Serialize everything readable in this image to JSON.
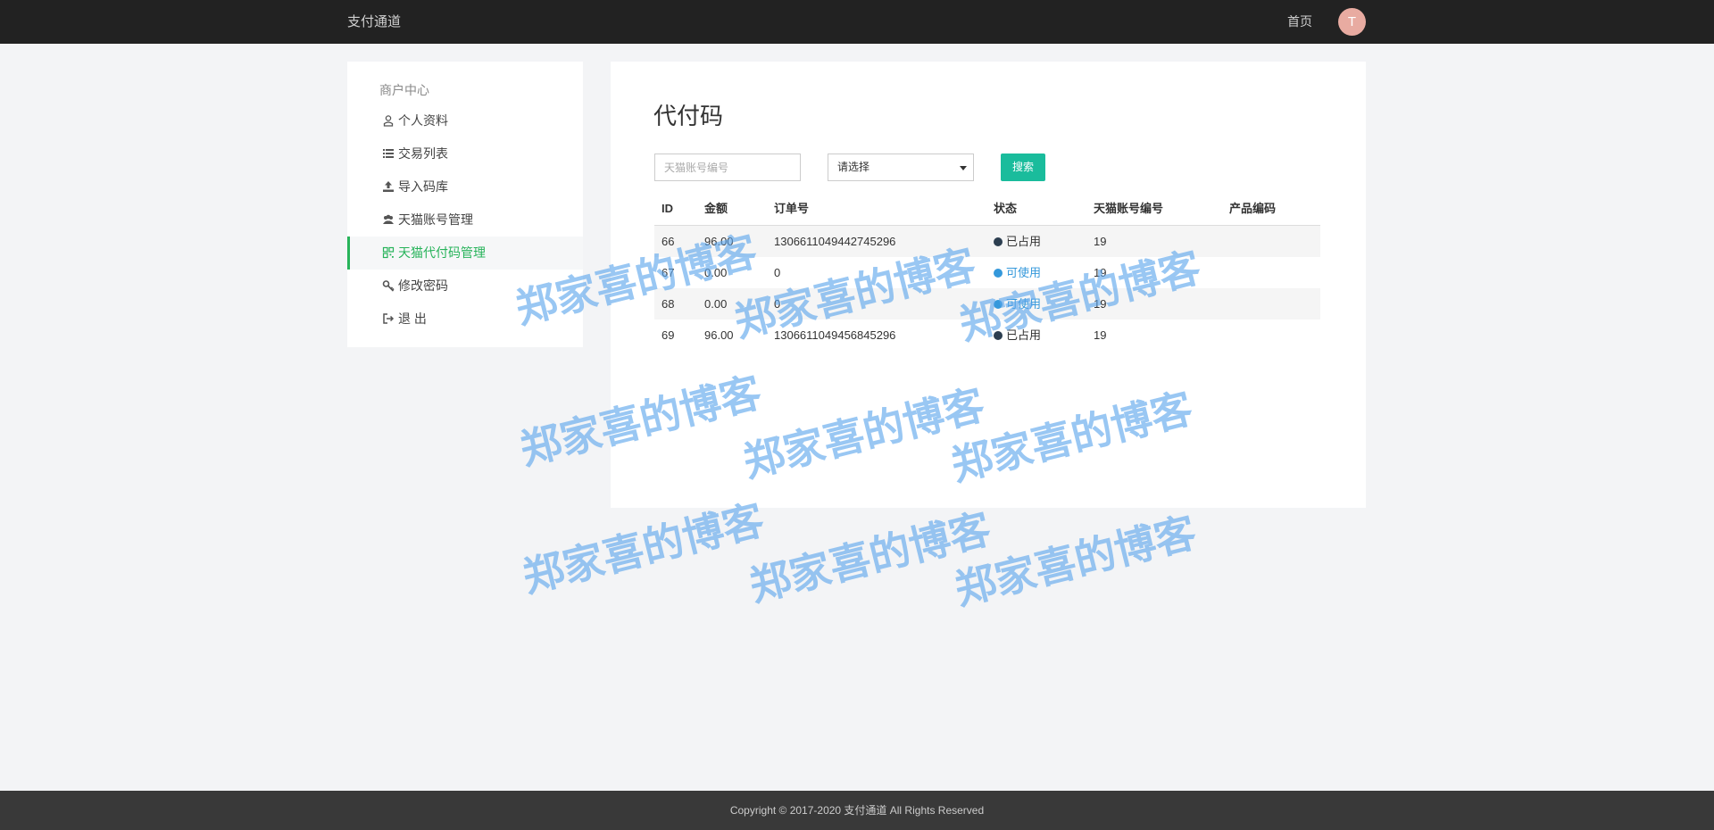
{
  "topbar": {
    "brand": "支付通道",
    "home": "首页",
    "avatar_letter": "T"
  },
  "sidebar": {
    "header": "商户中心",
    "items": [
      {
        "label": "个人资料",
        "icon": "user-icon"
      },
      {
        "label": "交易列表",
        "icon": "list-icon"
      },
      {
        "label": "导入码库",
        "icon": "upload-icon"
      },
      {
        "label": "天猫账号管理",
        "icon": "users-icon"
      },
      {
        "label": "天猫代付码管理",
        "icon": "qrcode-icon",
        "active": true
      },
      {
        "label": "修改密码",
        "icon": "key-icon"
      },
      {
        "label": "退 出",
        "icon": "logout-icon"
      }
    ],
    "accent_color": "#27b35a"
  },
  "main": {
    "title": "代付码",
    "search": {
      "placeholder": "天猫账号编号",
      "select_value": "请选择",
      "button": "搜索"
    },
    "table": {
      "headers": [
        "ID",
        "金额",
        "订单号",
        "状态",
        "天猫账号编号",
        "产品编码"
      ],
      "rows": [
        [
          "66",
          "96.00",
          "1306611049442745296",
          "已占用",
          "19",
          ""
        ],
        [
          "67",
          "0.00",
          "0",
          "可使用",
          "19",
          ""
        ],
        [
          "68",
          "0.00",
          "0",
          "可使用",
          "19",
          ""
        ],
        [
          "69",
          "96.00",
          "1306611049456845296",
          "已占用",
          "19",
          ""
        ]
      ]
    }
  },
  "footer": {
    "copyright": "Copyright © 2017-2020 支付通道 All Rights Reserved"
  },
  "watermark": {
    "text": "郑家喜的博客"
  },
  "colors": {
    "topbar": "#222222",
    "search_button": "#1abc9c",
    "status_used": "#2c3e50",
    "status_free": "#3498db"
  }
}
